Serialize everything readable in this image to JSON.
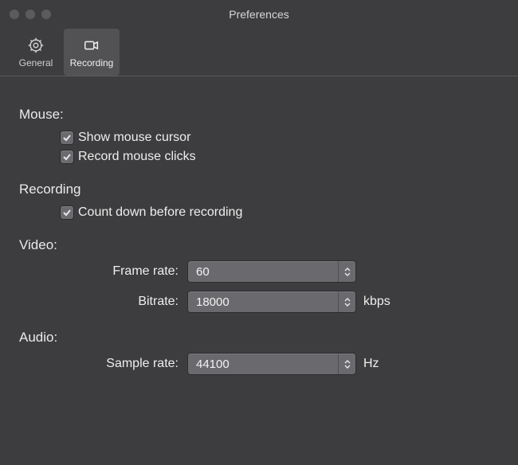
{
  "window": {
    "title": "Preferences"
  },
  "tabs": {
    "general": {
      "label": "General"
    },
    "recording": {
      "label": "Recording"
    }
  },
  "sections": {
    "mouse": {
      "label": "Mouse:",
      "show_cursor_label": "Show mouse cursor",
      "record_clicks_label": "Record mouse clicks",
      "show_cursor_checked": true,
      "record_clicks_checked": true
    },
    "recording": {
      "label": "Recording",
      "countdown_label": "Count down before recording",
      "countdown_checked": true
    },
    "video": {
      "label": "Video:",
      "frame_rate_label": "Frame rate:",
      "frame_rate_value": "60",
      "bitrate_label": "Bitrate:",
      "bitrate_value": "18000",
      "bitrate_unit": "kbps"
    },
    "audio": {
      "label": "Audio:",
      "sample_rate_label": "Sample rate:",
      "sample_rate_value": "44100",
      "sample_rate_unit": "Hz"
    }
  }
}
